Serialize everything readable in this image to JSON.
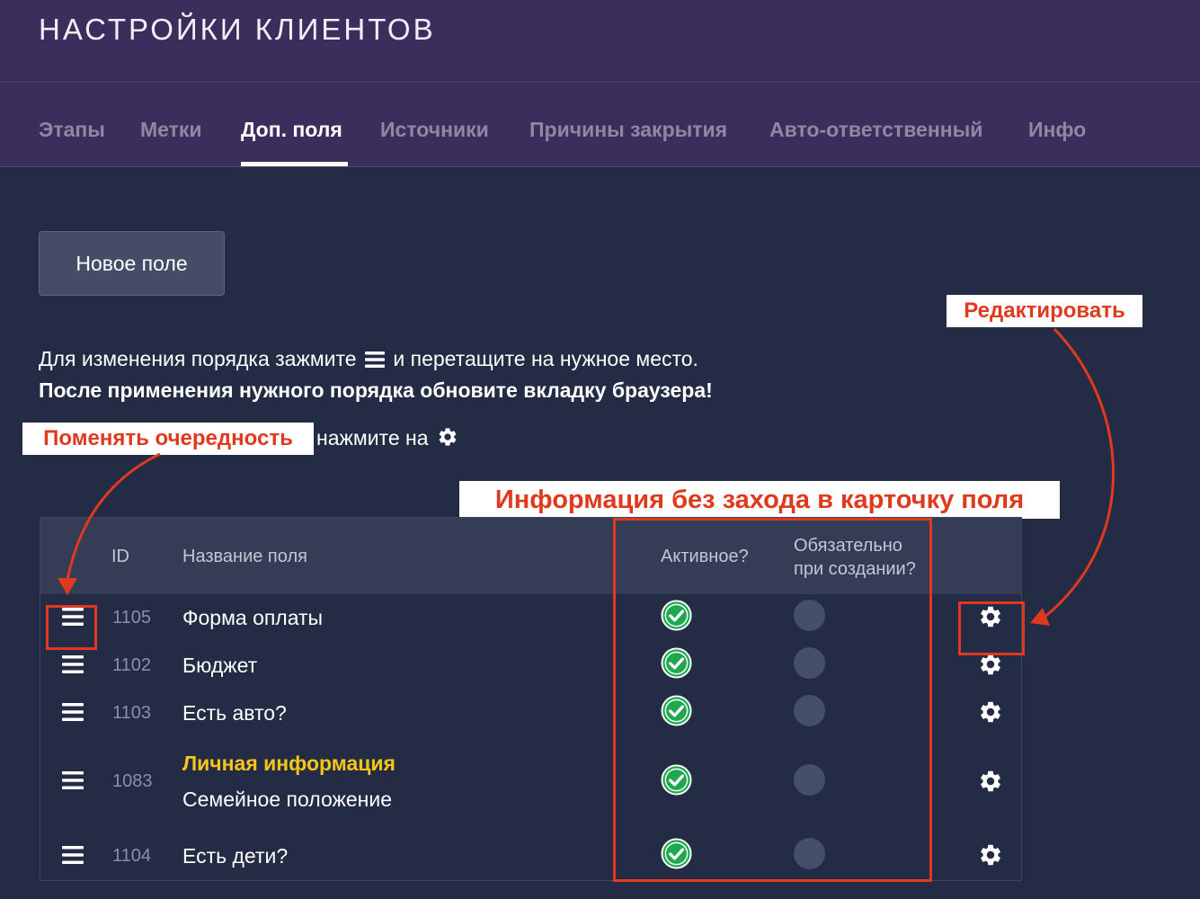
{
  "header": {
    "title": "НАСТРОЙКИ КЛИЕНТОВ"
  },
  "tabs": [
    {
      "label": "Этапы",
      "active": false
    },
    {
      "label": "Метки",
      "active": false
    },
    {
      "label": "Доп. поля",
      "active": true
    },
    {
      "label": "Источники",
      "active": false
    },
    {
      "label": "Причины закрытия",
      "active": false
    },
    {
      "label": "Авто-ответственный",
      "active": false
    },
    {
      "label": "Инфо",
      "active": false
    }
  ],
  "new_field_button": "Новое поле",
  "hints": {
    "line1_before": "Для изменения порядка зажмите",
    "line1_after": "и перетащите на нужное место.",
    "line2": "После применения нужного порядка обновите вкладку браузера!",
    "line3": "нажмите на"
  },
  "callouts": {
    "edit": "Редактировать",
    "reorder": "Поменять очередность",
    "info": "Информация без захода в карточку поля"
  },
  "table": {
    "headers": {
      "id": "ID",
      "name": "Название поля",
      "active": "Активное?",
      "required_line1": "Обязательно",
      "required_line2": "при создании?"
    },
    "rows": [
      {
        "id": "1105",
        "name": "Форма оплаты",
        "group": "",
        "active": true,
        "required": false
      },
      {
        "id": "1102",
        "name": "Бюджет",
        "group": "",
        "active": true,
        "required": false
      },
      {
        "id": "1103",
        "name": "Есть авто?",
        "group": "",
        "active": true,
        "required": false
      },
      {
        "id": "1083",
        "name": "Семейное положение",
        "group": "Личная информация",
        "active": true,
        "required": false
      },
      {
        "id": "1104",
        "name": "Есть дети?",
        "group": "",
        "active": true,
        "required": false
      }
    ]
  },
  "icons": {
    "drag": "hamburger-icon",
    "settings": "gear-icon",
    "active": "check-circle-icon"
  },
  "colors": {
    "header_bg": "#3b2d5c",
    "page_bg": "#232b45",
    "accent_red": "#e03a1e",
    "check_green": "#1fa84f",
    "group_yellow": "#f5c518"
  }
}
